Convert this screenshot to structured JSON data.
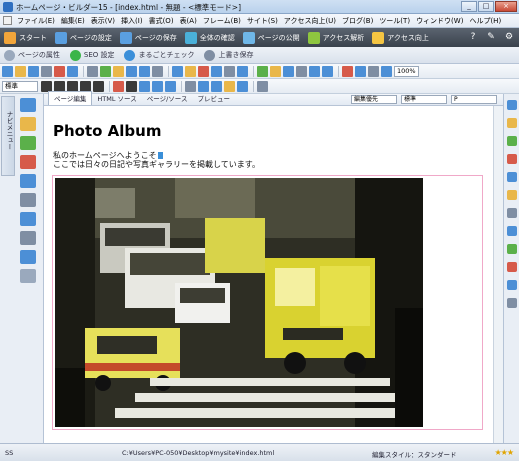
{
  "window": {
    "title": "ホームページ・ビルダー15 - [index.html - 無題 - <標準モード>]",
    "controls": {
      "minimize": "_",
      "maximize": "□",
      "close": "×"
    }
  },
  "menu": [
    "ファイル(E)",
    "編集(E)",
    "表示(V)",
    "挿入(I)",
    "書式(O)",
    "表(A)",
    "フレーム(B)",
    "サイト(S)",
    "アクセス向上(U)",
    "ブログ(B)",
    "ツール(T)",
    "ウィンドウ(W)",
    "ヘルプ(H)"
  ],
  "ribbon": {
    "items": [
      {
        "label": "スタート",
        "icon": "start-icon",
        "color": "#f2a53a"
      },
      {
        "label": "ページの設定",
        "icon": "page-settings-icon",
        "color": "#5a9fe0"
      },
      {
        "label": "ページの保存",
        "icon": "save-page-icon",
        "color": "#5a9fe0"
      },
      {
        "label": "全体の確認",
        "icon": "overview-icon",
        "color": "#4ab0d9"
      },
      {
        "label": "ページの公開",
        "icon": "publish-icon",
        "color": "#6fb7e8"
      },
      {
        "label": "アクセス解析",
        "icon": "analytics-icon",
        "color": "#8ec63f"
      },
      {
        "label": "アクセス向上",
        "icon": "access-up-icon",
        "color": "#f5c542"
      }
    ],
    "right_icons": [
      {
        "name": "help-icon",
        "glyph": "?"
      },
      {
        "name": "pin-icon",
        "glyph": "✎"
      },
      {
        "name": "settings-icon",
        "glyph": "⚙"
      }
    ]
  },
  "actionbar": {
    "items": [
      {
        "label": "ページの属性",
        "icon": "page-attributes-icon",
        "color": "#9aa9bd"
      },
      {
        "label": "SEO 設定",
        "icon": "seo-icon",
        "color": "#3bb54a"
      },
      {
        "label": "まるごとチェック",
        "icon": "full-check-icon",
        "color": "#3b8fd9"
      },
      {
        "label": "上書き保存",
        "icon": "overwrite-save-icon",
        "color": "#7f8ea3"
      }
    ]
  },
  "toolbar": {
    "row1_colors": [
      "#4c8fd6",
      "#e9b74a",
      "#4c8fd6",
      "#7f8ea3",
      "#d65a4a",
      "#4c8fd6",
      "#7f8ea3",
      "#5bb04a",
      "#e9b74a",
      "#4c8fd6",
      "#4c8fd6",
      "#7f8ea3",
      "#4c8fd6",
      "#e9b74a",
      "#d65a4a",
      "#4c8fd6",
      "#7f8ea3",
      "#4c8fd6",
      "#5bb04a",
      "#e9b74a",
      "#4c8fd6",
      "#7f8ea3",
      "#4c8fd6",
      "#4c8fd6",
      "#d65a4a",
      "#4c8fd6",
      "#7f8ea3",
      "#4c8fd6"
    ],
    "zoom": "100%",
    "style_select": "標準",
    "row2_colors": [
      "#3a3a3a",
      "#3a3a3a",
      "#3a3a3a",
      "#3a3a3a",
      "#3a3a3a",
      "#d65a4a",
      "#3a3a3a",
      "#4c8fd6",
      "#4c8fd6",
      "#4c8fd6",
      "#7f8ea3",
      "#4c8fd6",
      "#4c8fd6",
      "#e9b74a",
      "#4c8fd6",
      "#7f8ea3"
    ]
  },
  "doc_tabs": {
    "tabs": [
      {
        "label": "ページ編集",
        "active": true
      },
      {
        "label": "HTML ソース",
        "active": false
      },
      {
        "label": "ページ/ソース",
        "active": false
      },
      {
        "label": "プレビュー",
        "active": false
      }
    ],
    "edit_priority": "編集優先",
    "format": "標準",
    "paragraph": "P"
  },
  "left_panel": {
    "tab_label": "ナビメニュー",
    "tool_colors": [
      "#4c8fd6",
      "#e9b74a",
      "#5bb04a",
      "#d65a4a",
      "#4c8fd6",
      "#7f8ea3",
      "#4c8fd6",
      "#7f8ea3",
      "#4c8fd6",
      "#9aa9bd"
    ]
  },
  "right_panel": {
    "icon_colors": [
      "#4c8fd6",
      "#e9b74a",
      "#5bb04a",
      "#d65a4a",
      "#4c8fd6",
      "#e9b74a",
      "#7f8ea3",
      "#4c8fd6",
      "#5bb04a",
      "#d65a4a",
      "#4c8fd6",
      "#7f8ea3"
    ]
  },
  "page": {
    "title": "Photo Album",
    "intro_line1": "私のホームページへようこそ",
    "intro_line2": "ここでは日々の日記や写真ギャラリーを掲載しています。"
  },
  "status": {
    "mode": "SS",
    "path": "C:¥Users¥PC-050¥Desktop¥mysite¥index.html",
    "style": "編集スタイル：スタンダード",
    "rating": "★★★"
  }
}
